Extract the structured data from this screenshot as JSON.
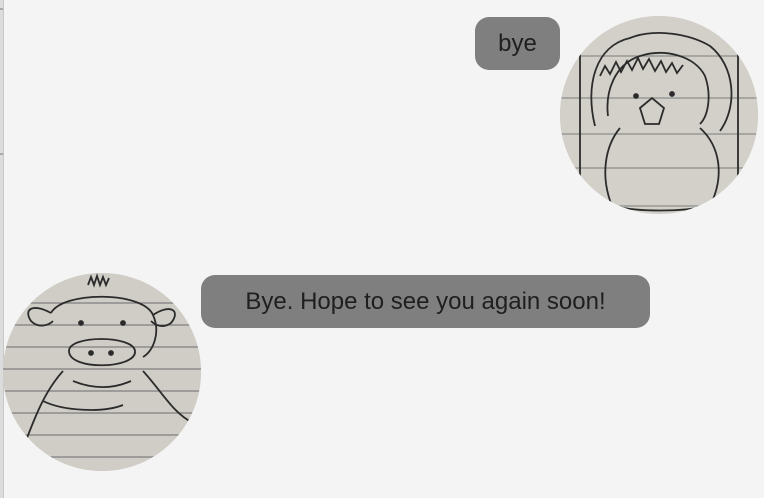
{
  "conversation": {
    "messages": [
      {
        "sender": "user",
        "text": "bye",
        "avatar": "penguin-sketch-avatar"
      },
      {
        "sender": "bot",
        "text": "Bye. Hope to see you again soon!",
        "avatar": "cow-sketch-avatar"
      }
    ]
  },
  "colors": {
    "background": "#f4f4f4",
    "bubble": "#7f7f7f",
    "bubble_text": "#1f1f1f"
  }
}
